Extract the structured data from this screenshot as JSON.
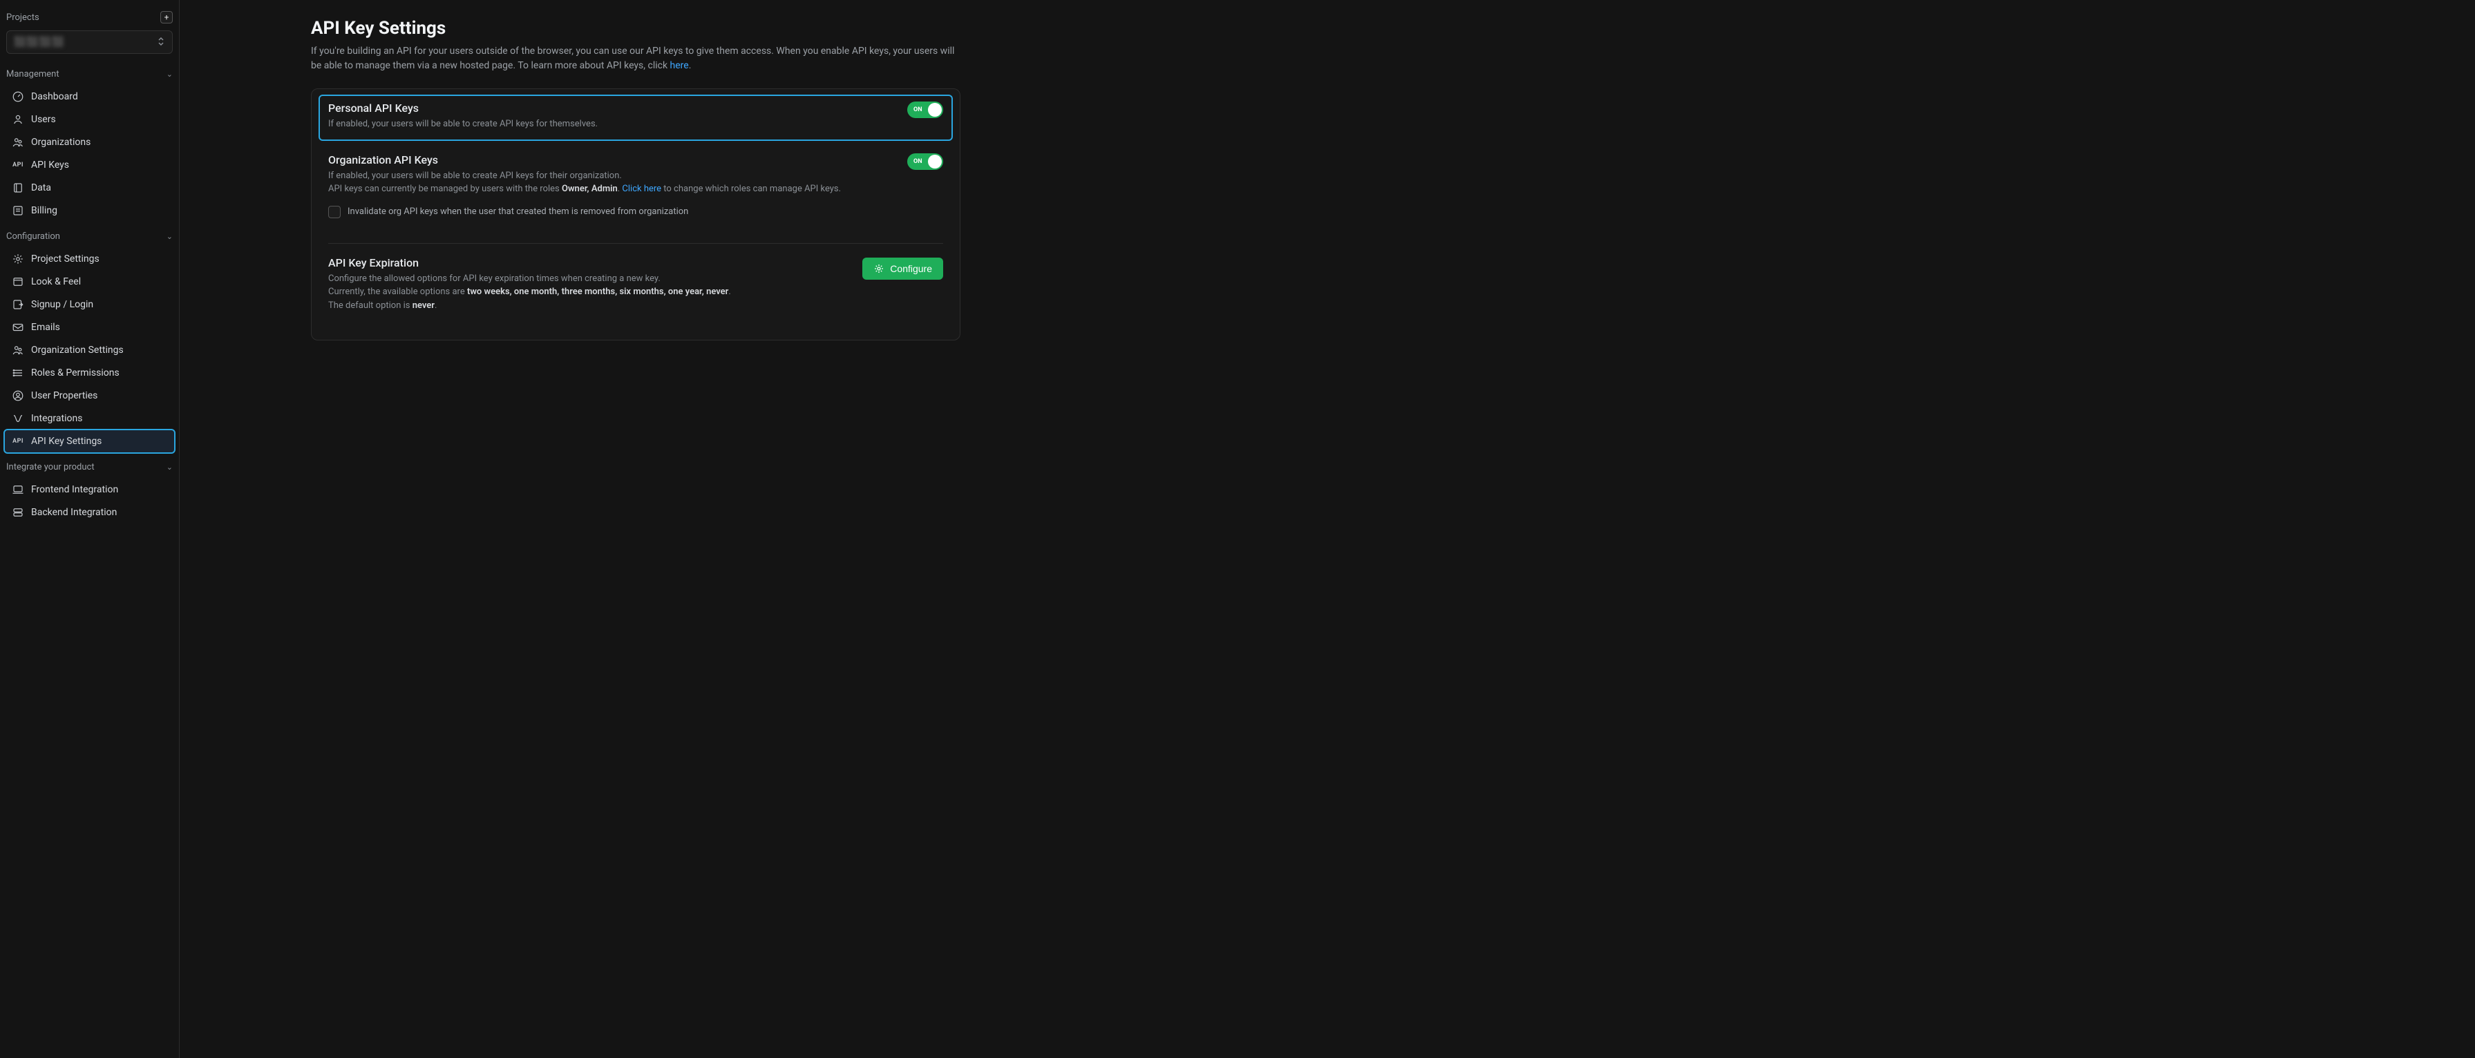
{
  "sidebar": {
    "projects_label": "Projects",
    "project_name": "⬛⬛⬛⬛",
    "sections": {
      "management": {
        "title": "Management",
        "items": [
          {
            "key": "dashboard",
            "label": "Dashboard",
            "icon": "gauge"
          },
          {
            "key": "users",
            "label": "Users",
            "icon": "user"
          },
          {
            "key": "organizations",
            "label": "Organizations",
            "icon": "org"
          },
          {
            "key": "api-keys",
            "label": "API Keys",
            "icon": "api"
          },
          {
            "key": "data",
            "label": "Data",
            "icon": "data"
          },
          {
            "key": "billing",
            "label": "Billing",
            "icon": "billing"
          }
        ]
      },
      "configuration": {
        "title": "Configuration",
        "items": [
          {
            "key": "project-settings",
            "label": "Project Settings",
            "icon": "gear"
          },
          {
            "key": "look-feel",
            "label": "Look & Feel",
            "icon": "look"
          },
          {
            "key": "signup-login",
            "label": "Signup / Login",
            "icon": "login"
          },
          {
            "key": "emails",
            "label": "Emails",
            "icon": "mail"
          },
          {
            "key": "org-settings",
            "label": "Organization Settings",
            "icon": "org"
          },
          {
            "key": "roles-perms",
            "label": "Roles & Permissions",
            "icon": "roles"
          },
          {
            "key": "user-props",
            "label": "User Properties",
            "icon": "userprop"
          },
          {
            "key": "integrations",
            "label": "Integrations",
            "icon": "integrations"
          },
          {
            "key": "api-key-settings",
            "label": "API Key Settings",
            "icon": "api",
            "active": true
          }
        ]
      },
      "integrate": {
        "title": "Integrate your product",
        "items": [
          {
            "key": "frontend-integration",
            "label": "Frontend Integration",
            "icon": "laptop"
          },
          {
            "key": "backend-integration",
            "label": "Backend Integration",
            "icon": "server"
          }
        ]
      }
    }
  },
  "page": {
    "title": "API Key Settings",
    "description_pre": "If you're building an API for your users outside of the browser, you can use our API keys to give them access. When you enable API keys, your users will be able to manage them via a new hosted page. To learn more about API keys, click ",
    "description_link": "here",
    "description_post": "."
  },
  "personal": {
    "title": "Personal API Keys",
    "desc": "If enabled, your users will be able to create API keys for themselves.",
    "toggle": "ON"
  },
  "org": {
    "title": "Organization API Keys",
    "desc_line1": "If enabled, your users will be able to create API keys for their organization.",
    "desc_line2_pre": "API keys can currently be managed by users with the roles ",
    "desc_line2_roles": "Owner, Admin",
    "desc_line2_mid": ". ",
    "desc_line2_link": "Click here",
    "desc_line2_post": " to change which roles can manage API keys.",
    "checkbox_label": "Invalidate org API keys when the user that created them is removed from organization",
    "toggle": "ON"
  },
  "expiration": {
    "title": "API Key Expiration",
    "line1": "Configure the allowed options for API key expiration times when creating a new key.",
    "line2_pre": "Currently, the available options are ",
    "line2_options": "two weeks, one month, three months, six months, one year, never",
    "line2_post": ".",
    "line3_pre": "The default option is ",
    "line3_default": "never",
    "line3_post": ".",
    "button": "Configure"
  }
}
